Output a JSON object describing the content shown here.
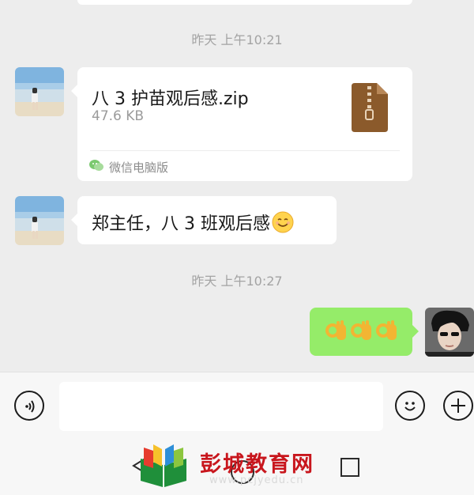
{
  "chat": {
    "timestamp_1": "昨天 上午10:21",
    "timestamp_2": "昨天 上午10:27",
    "file_message": {
      "file_name": "八 3 护苗观后感.zip",
      "file_size": "47.6 KB",
      "file_icon": "zip-file-icon",
      "source_icon": "wechat-icon",
      "source_label": "微信电脑版"
    },
    "text_message": {
      "text": "郑主任，八 3 班观后感",
      "emoji": "smiling-face-emoji"
    },
    "reply_message": {
      "emojis": [
        "ok-hand-emoji",
        "ok-hand-emoji",
        "ok-hand-emoji"
      ]
    }
  },
  "input_bar": {
    "voice_icon": "voice-icon",
    "emoji_icon": "emoji-face-icon",
    "add_icon": "plus-icon",
    "text_value": ""
  },
  "watermark": {
    "brand_name": "彭城教育网",
    "brand_url": "www.pcjyedu.cn",
    "logo": "book-logo"
  },
  "colors": {
    "background": "#ededed",
    "bubble_left": "#ffffff",
    "bubble_right": "#95ec69",
    "zip_icon": "#8b5a2b",
    "brand_red": "#c8161d"
  }
}
